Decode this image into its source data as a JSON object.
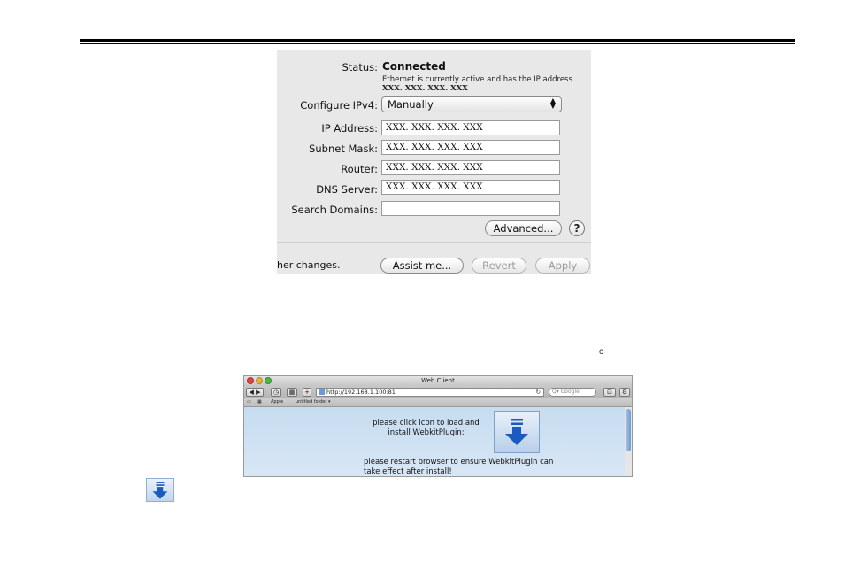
{
  "network": {
    "status_label": "Status:",
    "status_value": "Connected",
    "status_description_prefix": "Ethernet is currently active and has the IP address",
    "status_description_ip": "XXX. XXX. XXX. XXX",
    "configure_label": "Configure IPv4:",
    "configure_value": "Manually",
    "ip_label": "IP Address:",
    "ip_value": "XXX. XXX. XXX. XXX",
    "subnet_label": "Subnet Mask:",
    "subnet_value": "XXX. XXX. XXX. XXX",
    "router_label": "Router:",
    "router_value": "XXX. XXX. XXX. XXX",
    "dns_label": "DNS Server:",
    "dns_value": "XXX. XXX. XXX. XXX",
    "search_label": "Search Domains:",
    "search_value": "",
    "advanced_label": "Advanced...",
    "help_label": "?",
    "footnote": "her changes.",
    "assist_label": "Assist me...",
    "revert_label": "Revert",
    "apply_label": "Apply"
  },
  "refresh_glyph": "c",
  "browser": {
    "window_title": "Web Client",
    "url": "http://192.168.1.100:81",
    "search_placeholder": "Q▾ Google",
    "bookmarks": [
      "Apple",
      "untitled folder ▾"
    ],
    "message_install": "please click icon to load and install WebkitPlugin:",
    "message_restart": "please restart browser to ensure WebkitPlugin can take effect after install!"
  },
  "icons": {
    "install": "download-arrow-icon",
    "color_arrow": "#1a5bbf",
    "color_panel_bg": "#e8e8e8",
    "color_page_bg": "#c6dcf0"
  }
}
